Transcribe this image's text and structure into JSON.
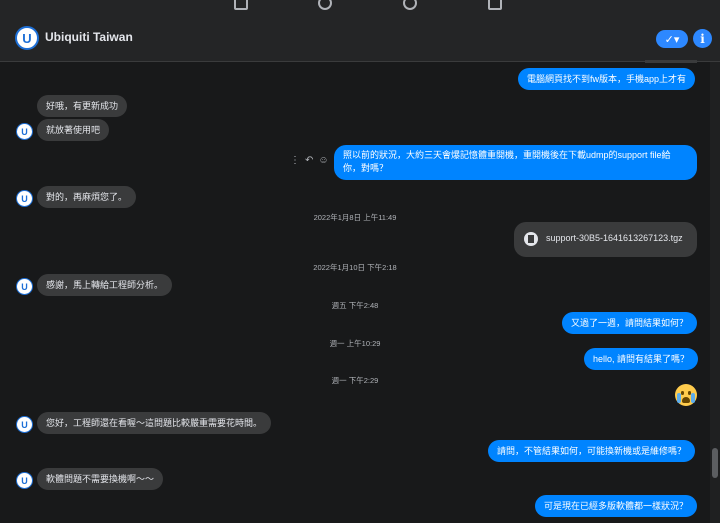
{
  "app": {
    "title": "Ubiquiti Taiwan"
  },
  "header": {
    "status_icon": "check-icon",
    "info_label": "i"
  },
  "messages": [
    {
      "side": "out",
      "text": "電腦網頁找不到fw版本，手機app上才有"
    },
    {
      "side": "in",
      "text": "好哦，有更新成功"
    },
    {
      "side": "in",
      "text": "就放著使用吧"
    },
    {
      "side": "out",
      "text_lines": [
        "照以前的狀況，大約三天會爆記憶體重開機，重開機後在下載udmp的support file給",
        "你，對嗎？"
      ]
    },
    {
      "side": "in",
      "text": "對的，再麻煩您了。"
    },
    {
      "side": "out",
      "type": "file",
      "text": "support-30B5-1641613267123.tgz"
    },
    {
      "side": "in",
      "text": "感謝，馬上轉給工程師分析。"
    },
    {
      "side": "out",
      "text": "又過了一週，請問結果如何？"
    },
    {
      "side": "out",
      "text": "hello, 請問有結果了嗎？"
    },
    {
      "side": "out",
      "type": "emoji",
      "text": ""
    },
    {
      "side": "in",
      "text": "您好，工程師還在看喔～這問題比較嚴重需要花時間。"
    },
    {
      "side": "out",
      "text": "請問，不管結果如何，可能換新機或是維修嗎？"
    },
    {
      "side": "in",
      "text": "軟體問題不需要換機啊～～"
    },
    {
      "side": "out",
      "text": "可是現在已經多版軟體都一樣狀況？"
    }
  ],
  "timestamps": [
    "2022年1月8日 上午11:49",
    "2022年1月10日 下午2:18",
    "週五 下午2:48",
    "週一 上午10:29",
    "週一 下午2:29"
  ],
  "avatar_letter": "U",
  "colors": {
    "outgoing": "#0084ff",
    "incoming": "#3a3b3c",
    "background": "#18191a",
    "accent": "#2d88ff"
  }
}
